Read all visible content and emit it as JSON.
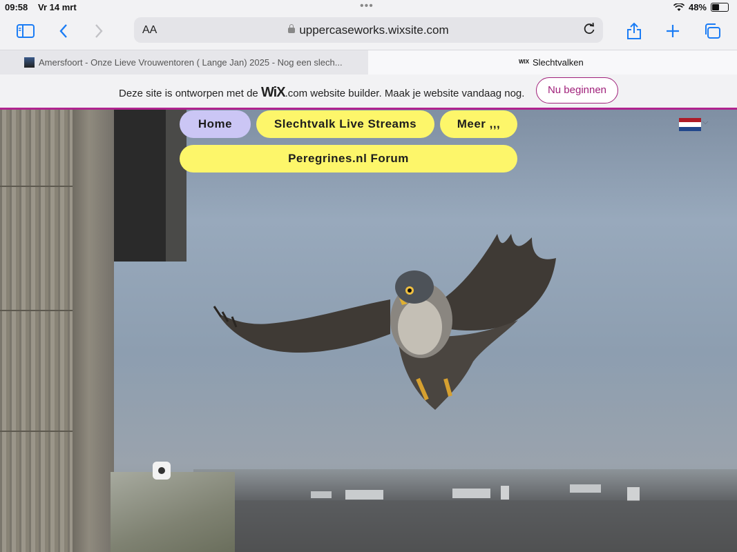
{
  "status_bar": {
    "time": "09:58",
    "date": "Vr 14 mrt",
    "battery_percent": "48%",
    "battery_level": 0.48
  },
  "browser": {
    "text_size_label": "AA",
    "url": "uppercaseworks.wixsite.com",
    "accent_color": "#1a7cf5",
    "tabs": [
      {
        "title": "Amersfoort - Onze Lieve Vrouwentoren ( Lange Jan) 2025 - Nog een slech...",
        "active": false
      },
      {
        "favicon_text": "WIX",
        "title": "Slechtvalken",
        "active": true
      }
    ]
  },
  "wix_banner": {
    "text_before": "Deze site is ontworpen met de",
    "brand": "WiX",
    "brand_suffix": ".com",
    "text_after": "website builder. Maak je website vandaag nog.",
    "cta_label": "Nu beginnen",
    "accent_color": "#a0207a"
  },
  "site_nav": {
    "items": [
      {
        "label": "Home",
        "color": "#cbc6f5"
      },
      {
        "label": "Slechtvalk Live Streams",
        "color": "#fdf66a"
      },
      {
        "label": "Meer ,,,",
        "color": "#fdf66a"
      },
      {
        "label": "Peregrines.nl Forum",
        "color": "#fdf66a"
      }
    ]
  },
  "language": {
    "flag_colors": [
      "#ae1c28",
      "#ffffff",
      "#21468b"
    ]
  },
  "hero": {
    "icons": [
      "falcon-image",
      "webcam-icon"
    ]
  }
}
